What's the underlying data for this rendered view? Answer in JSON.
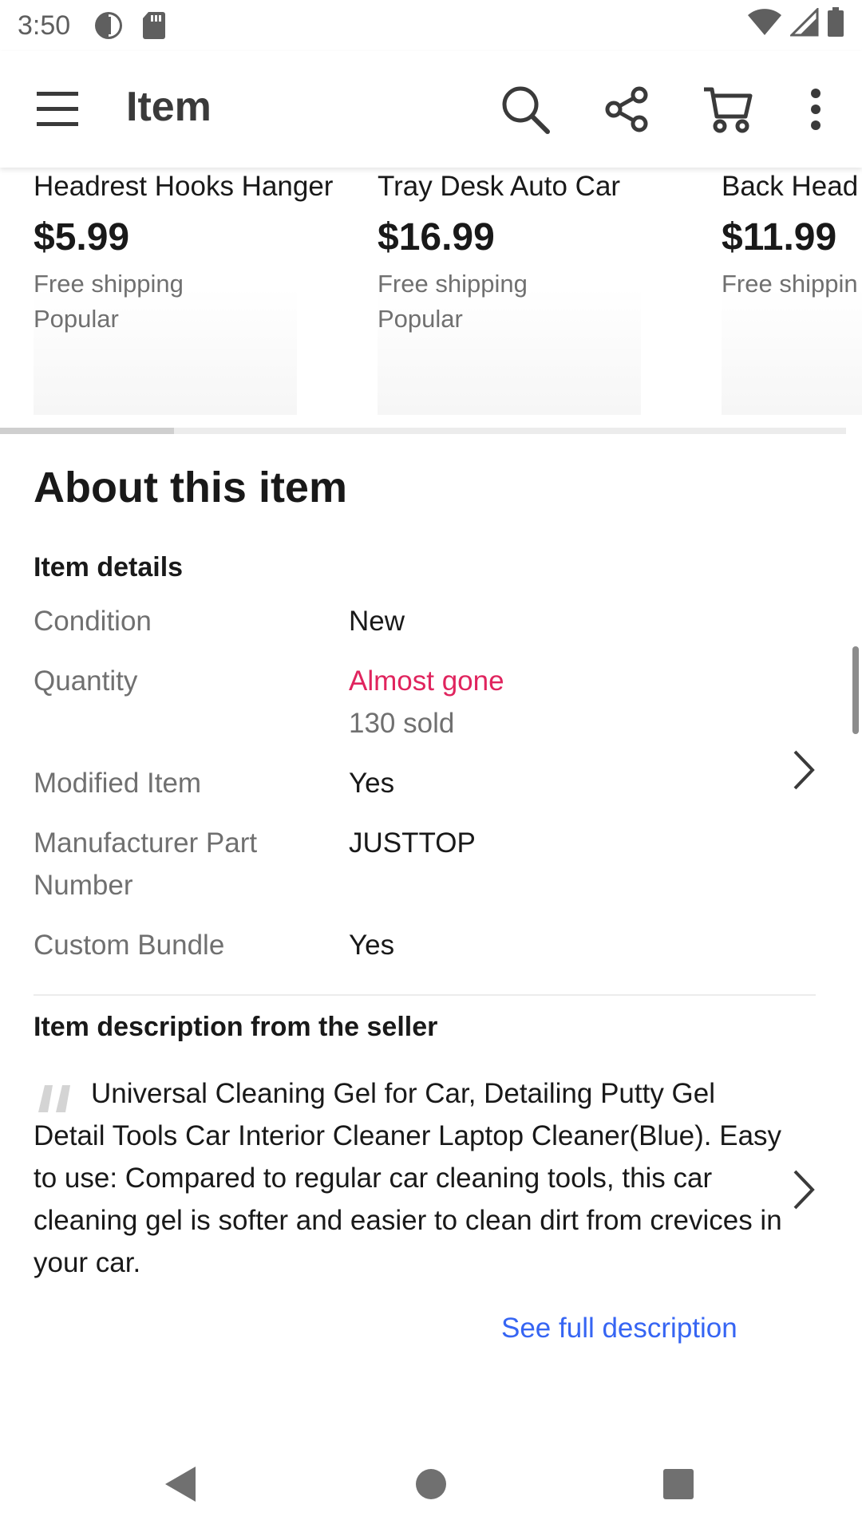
{
  "status_bar": {
    "time": "3:50",
    "icons": [
      "data-saver-icon",
      "sd-card-icon",
      "wifi-icon",
      "signal-icon",
      "battery-icon"
    ]
  },
  "app_bar": {
    "title": "Item",
    "icons": [
      "menu-icon",
      "search-icon",
      "share-icon",
      "cart-icon",
      "more-vert-icon"
    ]
  },
  "carousel": {
    "items": [
      {
        "title": "Headrest Hooks Hanger",
        "price": "$5.99",
        "shipping": "Free shipping",
        "badge": "Popular"
      },
      {
        "title": "Tray Desk Auto Car",
        "price": "$16.99",
        "shipping": "Free shipping",
        "badge": "Popular"
      },
      {
        "title": "Back Head",
        "price": "$11.99",
        "shipping": "Free shippin",
        "badge": ""
      }
    ]
  },
  "about": {
    "title": "About this item",
    "details_title": "Item details",
    "rows": [
      {
        "label": "Condition",
        "value": "New"
      },
      {
        "label": "Quantity",
        "value": "Almost gone",
        "sub_value": "130 sold"
      },
      {
        "label": "Modified Item",
        "value": "Yes"
      },
      {
        "label_line1": "Manufacturer Part",
        "label_line2": "Number",
        "value": "JUSTTOP"
      },
      {
        "label": "Custom Bundle",
        "value": "Yes"
      }
    ],
    "description_title": "Item description from the seller",
    "description": "Universal Cleaning Gel for Car, Detailing Putty Gel Detail Tools Car Interior Cleaner Laptop Cleaner(Blue). Easy to use: Compared to regular car cleaning tools, this car cleaning gel is softer and easier to clean dirt from crevices in your car.",
    "see_full": "See full description"
  },
  "colors": {
    "alert": "#e0245e",
    "link": "#3665f3",
    "muted_text": "#707070",
    "primary_text": "#191919"
  },
  "nav_bar": {
    "icons": [
      "back-icon",
      "home-icon",
      "recents-icon"
    ]
  }
}
